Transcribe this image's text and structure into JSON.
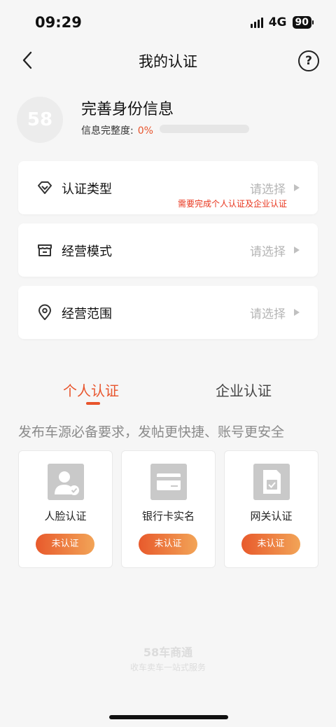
{
  "status_bar": {
    "time": "09:29",
    "network": "4G",
    "battery": "90"
  },
  "nav": {
    "title": "我的认证",
    "back_icon": "chevron-left-icon",
    "help_icon": "question-circle-icon",
    "help_glyph": "?"
  },
  "profile": {
    "avatar_text": "58",
    "title": "完善身份信息",
    "progress_label": "信息完整度:",
    "progress_value": "0%",
    "progress_fraction": 0
  },
  "cards": [
    {
      "label": "认证类型",
      "value": "请选择",
      "icon": "diamond-icon",
      "warning": "需要完成个人认证及企业认证"
    },
    {
      "label": "经营模式",
      "value": "请选择",
      "icon": "store-icon"
    },
    {
      "label": "经营范围",
      "value": "请选择",
      "icon": "location-pin-icon"
    }
  ],
  "tabs": [
    {
      "label": "个人认证",
      "active": true
    },
    {
      "label": "企业认证",
      "active": false
    }
  ],
  "tagline": "发布车源必备要求，发帖更快捷、账号更安全",
  "certifications": [
    {
      "label": "人脸认证",
      "status": "未认证",
      "icon": "face-id-icon"
    },
    {
      "label": "银行卡实名",
      "status": "未认证",
      "icon": "bank-card-icon"
    },
    {
      "label": "网关认证",
      "status": "未认证",
      "icon": "sim-card-icon"
    }
  ],
  "footer": {
    "brand": "58车商通",
    "slogan": "收车卖车一站式服务"
  },
  "colors": {
    "accent": "#e8542c",
    "warning": "#e8341c",
    "button_gradient_start": "#e85a2c",
    "button_gradient_end": "#f2a457"
  }
}
